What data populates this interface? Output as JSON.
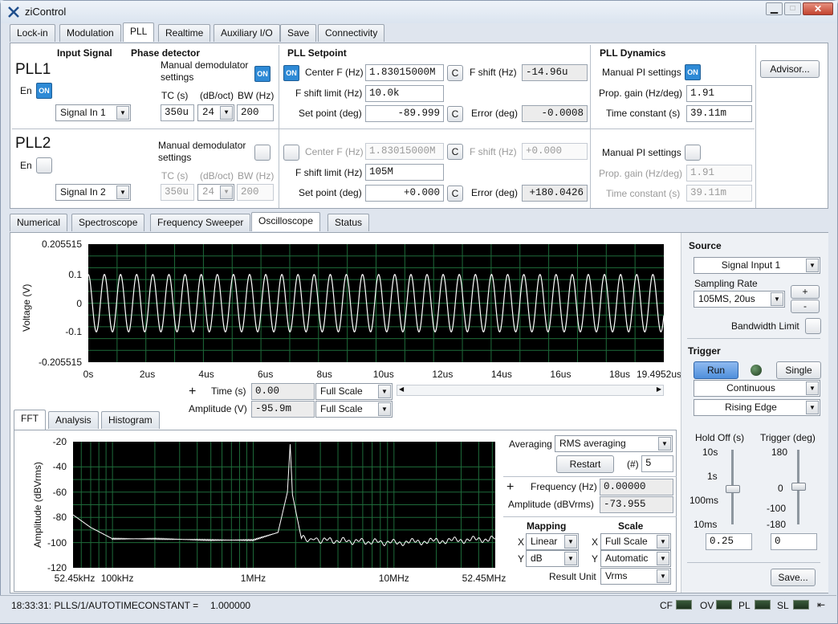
{
  "window": {
    "title": "ziControl"
  },
  "main_tabs": [
    "Lock-in",
    "Modulation",
    "PLL",
    "Realtime",
    "Auxiliary I/O",
    "Save",
    "Connectivity"
  ],
  "main_tab_selected": "PLL",
  "sections": {
    "input_signal": "Input Signal",
    "phase_detector": "Phase detector",
    "pll_setpoint": "PLL Setpoint",
    "pll_dynamics": "PLL Dynamics"
  },
  "pll1": {
    "name": "PLL1",
    "en_label": "En",
    "en_state": "ON",
    "input": "Signal In 1",
    "manual_demod": "Manual demodulator settings",
    "manual_demod_state": "ON",
    "tc_label": "TC (s)",
    "slope_label": "(dB/oct)",
    "bw_label": "BW (Hz)",
    "tc": "350u",
    "slope": "24",
    "bw": "200",
    "center_f_state": "ON",
    "center_f_label": "Center F (Hz)",
    "center_f": "1.83015000M",
    "c": "C",
    "fshift_label": "F shift (Hz)",
    "fshift": "-14.96u",
    "fshift_limit_label": "F shift limit (Hz)",
    "fshift_limit": "10.0k",
    "setpoint_label": "Set point (deg)",
    "setpoint": "-89.999",
    "error_label": "Error (deg)",
    "error": "-0.0008",
    "manual_pi": "Manual PI settings",
    "manual_pi_state": "ON",
    "prop_gain_label": "Prop. gain (Hz/deg)",
    "prop_gain": "1.91",
    "time_const_label": "Time constant (s)",
    "time_const": "39.11m"
  },
  "pll2": {
    "name": "PLL2",
    "en_label": "En",
    "input": "Signal In 2",
    "manual_demod": "Manual demodulator settings",
    "tc_label": "TC (s)",
    "slope_label": "(dB/oct)",
    "bw_label": "BW (Hz)",
    "tc": "350u",
    "slope": "24",
    "bw": "200",
    "center_f_label": "Center F (Hz)",
    "center_f": "1.83015000M",
    "c": "C",
    "fshift_label": "F shift (Hz)",
    "fshift": "+0.000",
    "fshift_limit_label": "F shift limit (Hz)",
    "fshift_limit": "105M",
    "setpoint_label": "Set point (deg)",
    "setpoint": "+0.000",
    "error_label": "Error (deg)",
    "error": "+180.0426",
    "manual_pi": "Manual PI settings",
    "prop_gain_label": "Prop. gain (Hz/deg)",
    "prop_gain": "1.91",
    "time_const_label": "Time constant (s)",
    "time_const": "39.11m"
  },
  "advisor": "Advisor...",
  "tool_tabs": [
    "Numerical",
    "Spectroscope",
    "Frequency Sweeper",
    "Oscilloscope",
    "Status"
  ],
  "tool_tab_selected": "Oscilloscope",
  "scope": {
    "ylabel": "Voltage (V)",
    "cursor_time_label": "Time (s)",
    "cursor_time": "0.00",
    "cursor_time_scale": "Full Scale",
    "cursor_amp_label": "Amplitude (V)",
    "cursor_amp": "-95.9m",
    "cursor_amp_scale": "Full Scale"
  },
  "chart_data": [
    {
      "type": "line",
      "ylabel": "Voltage (V)",
      "x_ticks": [
        "0s",
        "2us",
        "4us",
        "6us",
        "8us",
        "10us",
        "12us",
        "14us",
        "16us",
        "18us",
        "19.4952us"
      ],
      "y_ticks": [
        "0.205515",
        "0.1",
        "0",
        "-0.1",
        "-0.205515"
      ],
      "xlim": [
        0,
        19.4952
      ],
      "ylim": [
        -0.205515,
        0.205515
      ],
      "series": [
        {
          "amplitude": 0.1,
          "frequency_MHz": 1.83015,
          "x_unit": "us"
        }
      ],
      "grid": true
    },
    {
      "type": "line",
      "ylabel": "Amplitude (dBVrms)",
      "x_ticks": [
        "52.45kHz",
        "100kHz",
        "1MHz",
        "10MHz",
        "52.45MHz"
      ],
      "y_ticks": [
        "-20",
        "-40",
        "-60",
        "-80",
        "-100",
        "-120"
      ],
      "xscale": "log",
      "xlim": [
        52450,
        52450000
      ],
      "ylim": [
        -120,
        -20
      ],
      "series": [
        {
          "x": [
            52450,
            70000,
            100000,
            200000,
            500000,
            1000000,
            1500000,
            1750000,
            1830150,
            1900000,
            2200000,
            3000000,
            10000000,
            52450000
          ],
          "y": [
            -78,
            -88,
            -97,
            -97,
            -98,
            -98,
            -92,
            -60,
            -22,
            -62,
            -97,
            -98,
            -100,
            -97
          ]
        }
      ],
      "grid": true
    }
  ],
  "source": {
    "title": "Source",
    "input": "Signal Input 1",
    "sampling_label": "Sampling Rate",
    "sampling": "105MS, 20us",
    "plus": "+",
    "minus": "-",
    "bw_limit": "Bandwidth Limit"
  },
  "trigger": {
    "title": "Trigger",
    "run": "Run",
    "single": "Single",
    "mode": "Continuous",
    "edge": "Rising Edge",
    "holdoff_label": "Hold Off (s)",
    "holdoff_ticks": [
      "10s",
      "1s",
      "100ms",
      "10ms"
    ],
    "holdoff": "0.25",
    "level_label": "Trigger (deg)",
    "level_ticks": [
      "180",
      "0",
      "-100",
      "-180"
    ],
    "level": "0",
    "save": "Save..."
  },
  "sub_tabs": [
    "FFT",
    "Analysis",
    "Histogram"
  ],
  "sub_tab_selected": "FFT",
  "fft": {
    "averaging_label": "Averaging",
    "averaging": "RMS averaging",
    "restart": "Restart",
    "count_label": "(#)",
    "count": "5",
    "freq_label": "Frequency (Hz)",
    "freq": "0.00000",
    "amp_label": "Amplitude (dBVrms)",
    "amp": "-73.955",
    "mapping_label": "Mapping",
    "scale_label": "Scale",
    "x": "X",
    "y": "Y",
    "map_x": "Linear",
    "map_y": "dB",
    "scale_x": "Full Scale",
    "scale_y": "Automatic",
    "result_unit_label": "Result Unit",
    "result_unit": "Vrms"
  },
  "status": {
    "message": "18:33:31: PLLS/1/AUTOTIMECONSTANT =",
    "value": "1.000000",
    "leds": [
      "CF",
      "OV",
      "PL",
      "SL"
    ]
  },
  "colors": {
    "on": "#2e8ad6",
    "plot_bg": "#000000",
    "grid": "#1e6b3a",
    "trace": "#ffffff",
    "run": "#4f8fdc"
  }
}
